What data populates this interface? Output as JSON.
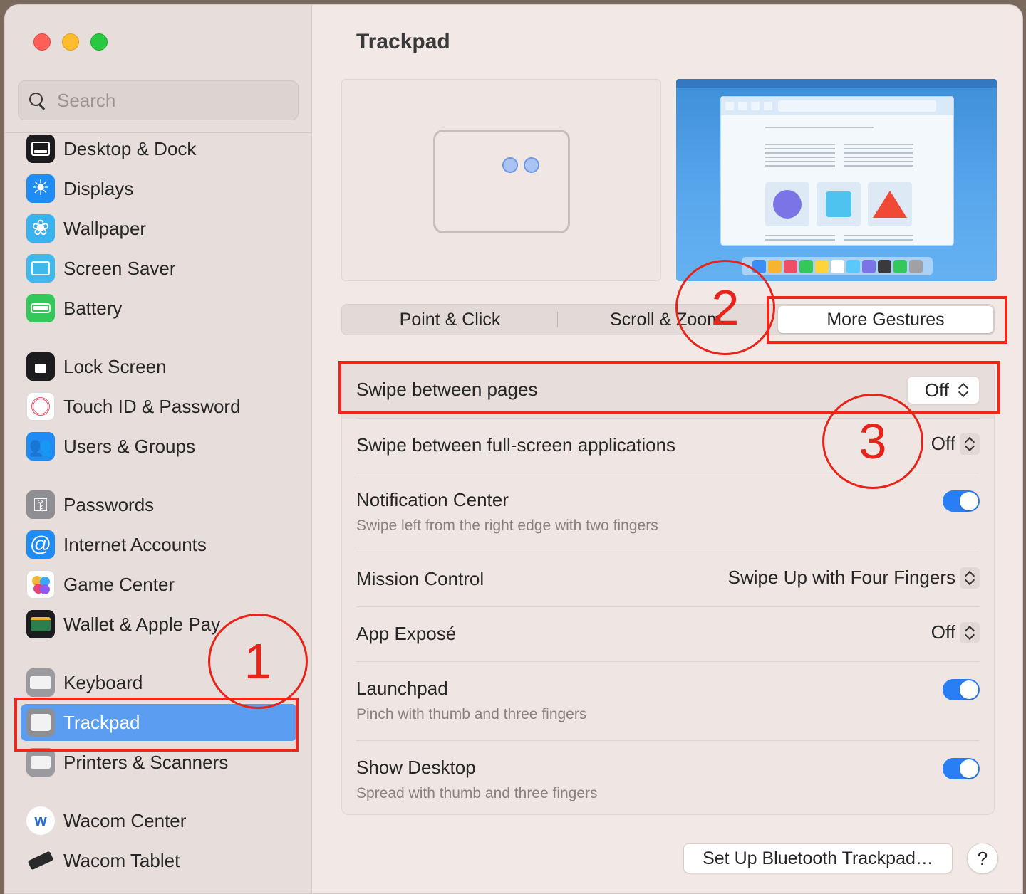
{
  "window": {
    "title": "Trackpad"
  },
  "sidebar": {
    "search_placeholder": "Search",
    "items": [
      {
        "label": "Desktop & Dock",
        "icon": "desktop-dock-icon"
      },
      {
        "label": "Displays",
        "icon": "displays-icon"
      },
      {
        "label": "Wallpaper",
        "icon": "wallpaper-icon"
      },
      {
        "label": "Screen Saver",
        "icon": "screen-saver-icon"
      },
      {
        "label": "Battery",
        "icon": "battery-icon"
      },
      {
        "label": "Lock Screen",
        "icon": "lock-screen-icon"
      },
      {
        "label": "Touch ID & Password",
        "icon": "touch-id-icon"
      },
      {
        "label": "Users & Groups",
        "icon": "users-groups-icon"
      },
      {
        "label": "Passwords",
        "icon": "passwords-icon"
      },
      {
        "label": "Internet Accounts",
        "icon": "internet-accounts-icon"
      },
      {
        "label": "Game Center",
        "icon": "game-center-icon"
      },
      {
        "label": "Wallet & Apple Pay",
        "icon": "wallet-icon"
      },
      {
        "label": "Keyboard",
        "icon": "keyboard-icon"
      },
      {
        "label": "Trackpad",
        "icon": "trackpad-icon",
        "selected": true
      },
      {
        "label": "Printers & Scanners",
        "icon": "printers-icon"
      },
      {
        "label": "Wacom Center",
        "icon": "wacom-center-icon"
      },
      {
        "label": "Wacom Tablet",
        "icon": "wacom-tablet-icon"
      }
    ]
  },
  "tabs": [
    {
      "label": "Point & Click",
      "selected": false
    },
    {
      "label": "Scroll & Zoom",
      "selected": false
    },
    {
      "label": "More Gestures",
      "selected": true
    }
  ],
  "settings": [
    {
      "title": "Swipe between pages",
      "control": "popup",
      "value": "Off"
    },
    {
      "title": "Swipe between full-screen applications",
      "control": "popup",
      "value": "Off"
    },
    {
      "title": "Notification Center",
      "subtitle": "Swipe left from the right edge with two fingers",
      "control": "toggle",
      "on": true
    },
    {
      "title": "Mission Control",
      "control": "popup",
      "value": "Swipe Up with Four Fingers"
    },
    {
      "title": "App Exposé",
      "control": "popup",
      "value": "Off"
    },
    {
      "title": "Launchpad",
      "subtitle": "Pinch with thumb and three fingers",
      "control": "toggle",
      "on": true
    },
    {
      "title": "Show Desktop",
      "subtitle": "Spread with thumb and three fingers",
      "control": "toggle",
      "on": true
    }
  ],
  "footer": {
    "setup_button": "Set Up Bluetooth Trackpad…",
    "help_button": "?"
  },
  "annotations": {
    "one": "1",
    "two": "2",
    "three": "3"
  },
  "colors": {
    "accent": "#2a7ef5",
    "selection": "#5b9df0",
    "annotation": "#f0261a"
  }
}
